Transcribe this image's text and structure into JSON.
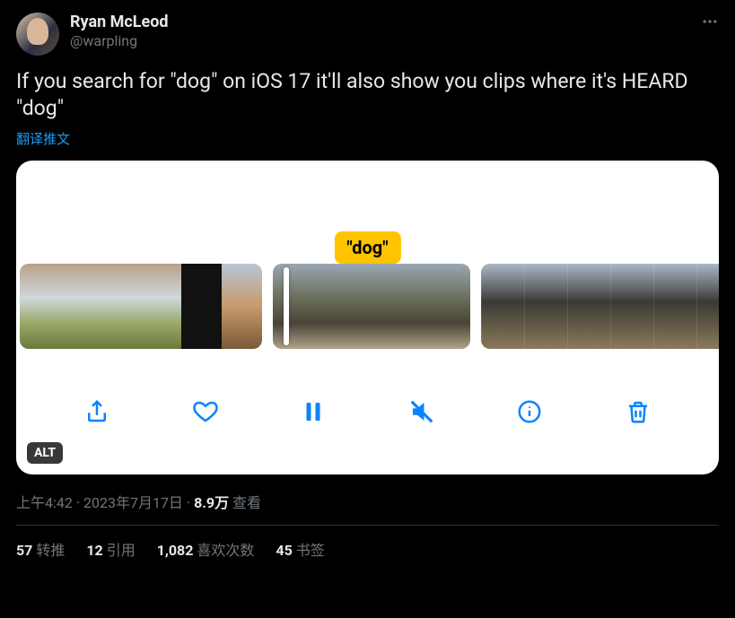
{
  "user": {
    "display_name": "Ryan McLeod",
    "handle": "@warpling"
  },
  "tweet": {
    "text": "If you search for \"dog\" on iOS 17 it'll also show you clips where it's HEARD \"dog\"",
    "translate_label": "翻译推文"
  },
  "media": {
    "caption_badge": "\"dog\"",
    "alt_label": "ALT",
    "toolbar_icons": {
      "share": "share-icon",
      "like": "heart-icon",
      "pause": "pause-icon",
      "mute": "mute-icon",
      "info": "info-icon",
      "trash": "trash-icon"
    }
  },
  "meta": {
    "time": "上午4:42",
    "date": "2023年7月17日",
    "views_num": "8.9万",
    "views_label": "查看",
    "separator": " · "
  },
  "stats": {
    "retweets_num": "57",
    "retweets_label": "转推",
    "quotes_num": "12",
    "quotes_label": "引用",
    "likes_num": "1,082",
    "likes_label": "喜欢次数",
    "bookmarks_num": "45",
    "bookmarks_label": "书签"
  }
}
